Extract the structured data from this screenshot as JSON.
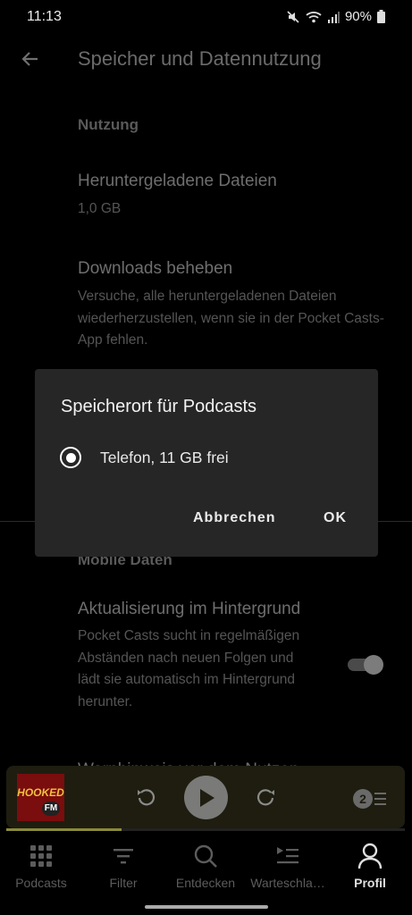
{
  "status_bar": {
    "time": "11:13",
    "battery": "90%"
  },
  "header": {
    "title": "Speicher und Datennutzung"
  },
  "sections": {
    "usage_header": "Nutzung",
    "downloaded_files_title": "Heruntergeladene Dateien",
    "downloaded_files_size": "1,0 GB",
    "fix_downloads_title": "Downloads beheben",
    "fix_downloads_desc": "Versuche, alle heruntergeladenen Dateien wiederherzustellen, wenn sie in der Pocket Casts-App fehlen.",
    "mobile_data_header": "Mobile Daten",
    "bg_refresh_title": "Aktualisierung im Hintergrund",
    "bg_refresh_desc": "Pocket Casts sucht in regelmäßigen Abständen nach neuen Folgen und lädt sie automatisch im Hintergrund herunter.",
    "bg_refresh_enabled": true,
    "next_item_partial": "Warnhinweis vor dem Nutzen"
  },
  "dialog": {
    "title": "Speicherort für Podcasts",
    "option_label": "Telefon, 11 GB frei",
    "option_selected": true,
    "cancel_label": "Abbrechen",
    "ok_label": "OK"
  },
  "player": {
    "artwork_text": "HOOKED",
    "artwork_badge": "FM",
    "queue_count": "2",
    "progress": 0.29
  },
  "nav": {
    "items": [
      {
        "label": "Podcasts",
        "icon": "grid-icon",
        "active": false
      },
      {
        "label": "Filter",
        "icon": "filter-icon",
        "active": false
      },
      {
        "label": "Entdecken",
        "icon": "search-icon",
        "active": false
      },
      {
        "label": "Warteschla…",
        "icon": "queue-icon",
        "active": false
      },
      {
        "label": "Profil",
        "icon": "profile-icon",
        "active": true
      }
    ]
  }
}
